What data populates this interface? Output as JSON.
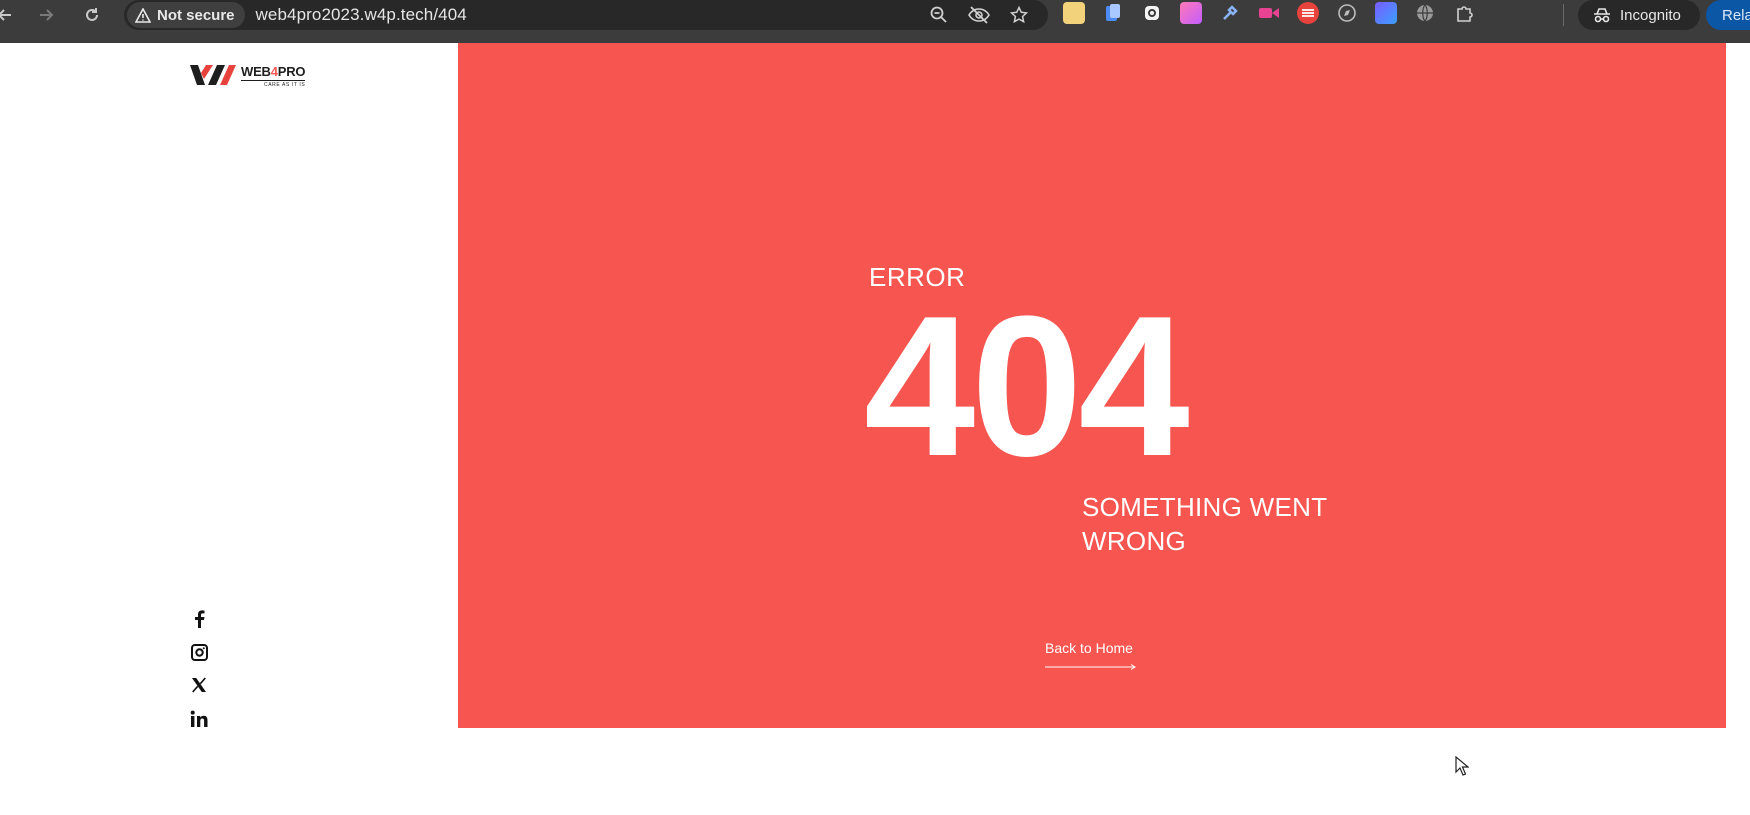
{
  "browser": {
    "security_label": "Not secure",
    "url": "web4pro2023.w4p.tech/404",
    "profile_label": "Incognito",
    "relaunch_label": "Rela"
  },
  "icons": {
    "back": "back-arrow-icon",
    "forward": "forward-arrow-icon",
    "reload": "reload-icon",
    "warning": "warning-triangle-icon",
    "zoom": "zoom-out-icon",
    "eye_off": "tracking-blocked-icon",
    "bookmark": "star-icon",
    "extensions": "puzzle-icon",
    "incognito": "incognito-icon",
    "facebook": "facebook-icon",
    "instagram": "instagram-icon",
    "x": "x-twitter-icon",
    "linkedin": "linkedin-icon"
  },
  "colors": {
    "hero_bg": "#f7554f",
    "chrome_bg": "#3c3c3c",
    "brand_accent": "#e8423d"
  },
  "site": {
    "logo_name_prefix": "WEB",
    "logo_name_digit": "4",
    "logo_name_suffix": "PRO",
    "logo_tagline": "CARE AS IT IS"
  },
  "error_page": {
    "label": "ERROR",
    "code": "404",
    "message": "SOMETHING WENT WRONG",
    "home_link": "Back to Home"
  }
}
